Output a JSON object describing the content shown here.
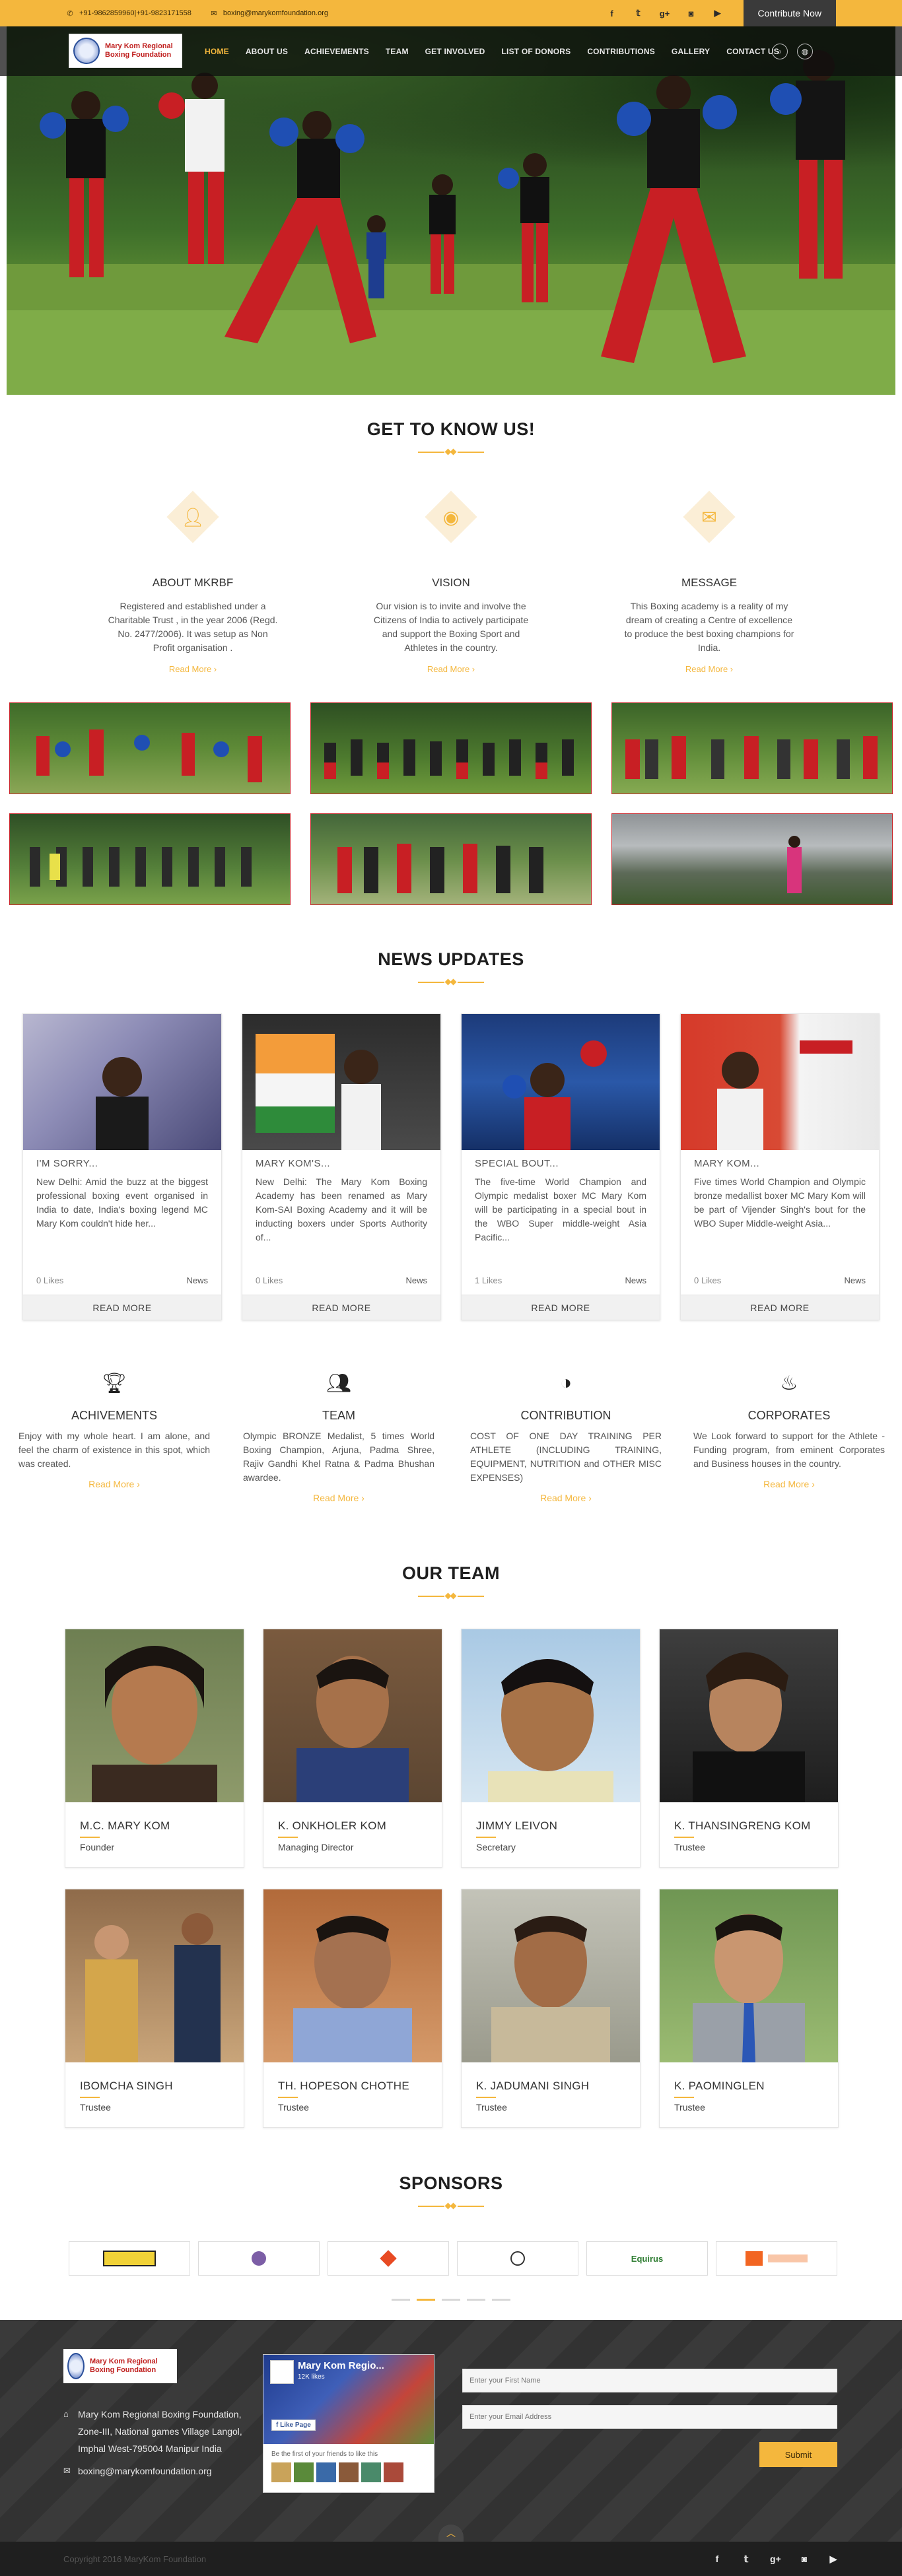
{
  "topbar": {
    "phone": "+91-9862859960|+91-9823171558",
    "email": "boxing@marykomfoundation.org",
    "social": [
      "facebook-icon",
      "twitter-icon",
      "google-plus-icon",
      "instagram-icon",
      "youtube-icon"
    ],
    "contribute_label": "Contribute Now"
  },
  "header": {
    "logo_text": "Mary Kom Regional Boxing Foundation",
    "menu": [
      "HOME",
      "ABOUT US",
      "ACHIEVEMENTS",
      "TEAM",
      "GET INVOLVED",
      "LIST OF DONORS",
      "CONTRIBUTIONS",
      "GALLERY",
      "CONTACT US"
    ],
    "active_index": 0
  },
  "about": {
    "title": "GET TO KNOW US!",
    "items": [
      {
        "icon": "user-icon",
        "heading": "ABOUT MKRBF",
        "text": "Registered and established under a Charitable Trust , in the year 2006 (Regd. No. 2477/2006). It was setup as Non Profit organisation .",
        "more": "Read More"
      },
      {
        "icon": "eye-icon",
        "heading": "VISION",
        "text": "Our vision is to invite and involve the Citizens of India to actively participate and support the Boxing Sport and Athletes in the country.",
        "more": "Read More"
      },
      {
        "icon": "envelope-icon",
        "heading": "MESSAGE",
        "text": "This Boxing academy is a reality of my dream of creating a Centre of excellence to produce the best boxing champions for India.",
        "more": "Read More"
      }
    ]
  },
  "news": {
    "title": "NEWS UPDATES",
    "items": [
      {
        "title": "I'M SORRY...",
        "text": "New Delhi: Amid the buzz at the biggest professional boxing event organised in India to date, India's boxing legend MC Mary Kom couldn't hide her...",
        "likes": "0 Likes",
        "category": "News",
        "button": "READ MORE"
      },
      {
        "title": "MARY KOM'S...",
        "text": "New Delhi: The Mary Kom Boxing Academy has been renamed as Mary Kom-SAI Boxing Academy and it will be inducting boxers under Sports Authority of...",
        "likes": "0 Likes",
        "category": "News",
        "button": "READ MORE"
      },
      {
        "title": "SPECIAL BOUT...",
        "text": "The five-time World Champion and Olympic medalist boxer MC Mary Kom will be participating in a special bout in the WBO Super middle-weight Asia Pacific...",
        "likes": "1 Likes",
        "category": "News",
        "button": "READ MORE"
      },
      {
        "title": "MARY KOM...",
        "text": "Five times World Champion and Olympic bronze medallist boxer MC Mary Kom will be part of Vijender Singh's bout for the WBO Super Middle-weight Asia...",
        "likes": "0 Likes",
        "category": "News",
        "button": "READ MORE"
      }
    ]
  },
  "features": [
    {
      "icon": "trophy-icon",
      "heading": "ACHIVEMENTS",
      "text": "Enjoy with my whole heart. I am alone, and feel the charm of existence in this spot, which was created.",
      "more": "Read More"
    },
    {
      "icon": "group-icon",
      "heading": "TEAM",
      "text": "Olympic BRONZE Medalist, 5 times World Boxing Champion, Arjuna, Padma Shree, Rajiv Gandhi Khel Ratna & Padma Bhushan awardee.",
      "more": "Read More"
    },
    {
      "icon": "contrast-icon",
      "heading": "CONTRIBUTION",
      "text": "COST OF ONE DAY TRAINING PER ATHLETE (INCLUDING TRAINING, EQUIPMENT, NUTRITION and OTHER MISC EXPENSES)",
      "more": "Read More"
    },
    {
      "icon": "fire-icon",
      "heading": "CORPORATES",
      "text": "We Look forward to support for the Athlete - Funding program, from eminent Corporates and Business houses in the country.",
      "more": "Read More"
    }
  ],
  "team": {
    "title": "OUR TEAM",
    "members": [
      {
        "name": "M.C. MARY KOM",
        "role": "Founder"
      },
      {
        "name": "K. ONKHOLER KOM",
        "role": "Managing Director"
      },
      {
        "name": "JIMMY LEIVON",
        "role": "Secretary"
      },
      {
        "name": "K. THANSINGRENG KOM",
        "role": "Trustee"
      },
      {
        "name": "IBOMCHA SINGH",
        "role": "Trustee"
      },
      {
        "name": "TH. HOPESON CHOTHE",
        "role": "Trustee"
      },
      {
        "name": "K. JADUMANI SINGH",
        "role": "Trustee"
      },
      {
        "name": "K. PAOMINGLEN",
        "role": "Trustee"
      }
    ]
  },
  "sponsors": {
    "title": "SPONSORS",
    "logos": [
      "Pepperfry-style logo",
      "ring logo",
      "red logo",
      "emblem logo",
      "Equirus",
      "Bank of Baroda"
    ]
  },
  "footer": {
    "logo_text": "Mary Kom Regional Boxing Foundation",
    "address": "Mary Kom Regional Boxing Foundation, Zone-III, National games Village Langol, Imphal West-795004 Manipur India",
    "email": "boxing@marykomfoundation.org",
    "fb_title": "Mary Kom Regio...",
    "fb_likes": "12K likes",
    "fb_like_btn": "Like Page",
    "fb_friends": "Be the first of your friends to like this",
    "first_name_placeholder": "Enter your First Name",
    "email_placeholder": "Enter your Email Address",
    "submit_label": "Submit",
    "copyright": "Copyright 2016 MaryKom Foundation"
  }
}
